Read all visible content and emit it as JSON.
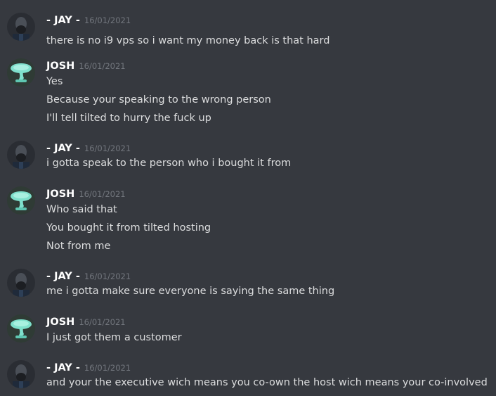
{
  "colors": {
    "background": "#36393f",
    "username": "#ffffff",
    "timestamp": "#72767d",
    "text": "#dcddde"
  },
  "messages": [
    {
      "author": "- JAY -",
      "avatar_icon": "dark-bearded-man-avatar-icon",
      "timestamp": "16/01/2021",
      "lines": [
        "there is no i9 vps so i want my money back is that hard"
      ]
    },
    {
      "author": "JOSH",
      "avatar_icon": "teal-mushroom-avatar-icon",
      "timestamp": "16/01/2021",
      "lines": [
        "Yes",
        "Because your speaking to the wrong person",
        "I'll tell tilted to hurry the fuck up"
      ]
    },
    {
      "author": "- JAY -",
      "avatar_icon": "dark-bearded-man-avatar-icon",
      "timestamp": "16/01/2021",
      "lines": [
        "i gotta speak to the person who i bought it from"
      ]
    },
    {
      "author": "JOSH",
      "avatar_icon": "teal-mushroom-avatar-icon",
      "timestamp": "16/01/2021",
      "lines": [
        "Who said that",
        "You bought it from tilted hosting",
        "Not from me"
      ]
    },
    {
      "author": "- JAY -",
      "avatar_icon": "dark-bearded-man-avatar-icon",
      "timestamp": "16/01/2021",
      "lines": [
        "me i gotta make sure everyone is saying the same thing"
      ]
    },
    {
      "author": "JOSH",
      "avatar_icon": "teal-mushroom-avatar-icon",
      "timestamp": "16/01/2021",
      "lines": [
        "I just got them a customer"
      ]
    },
    {
      "author": "- JAY -",
      "avatar_icon": "dark-bearded-man-avatar-icon",
      "timestamp": "16/01/2021",
      "lines": [
        "and your the executive wich means you co-own the host wich means your co-involved"
      ]
    }
  ]
}
